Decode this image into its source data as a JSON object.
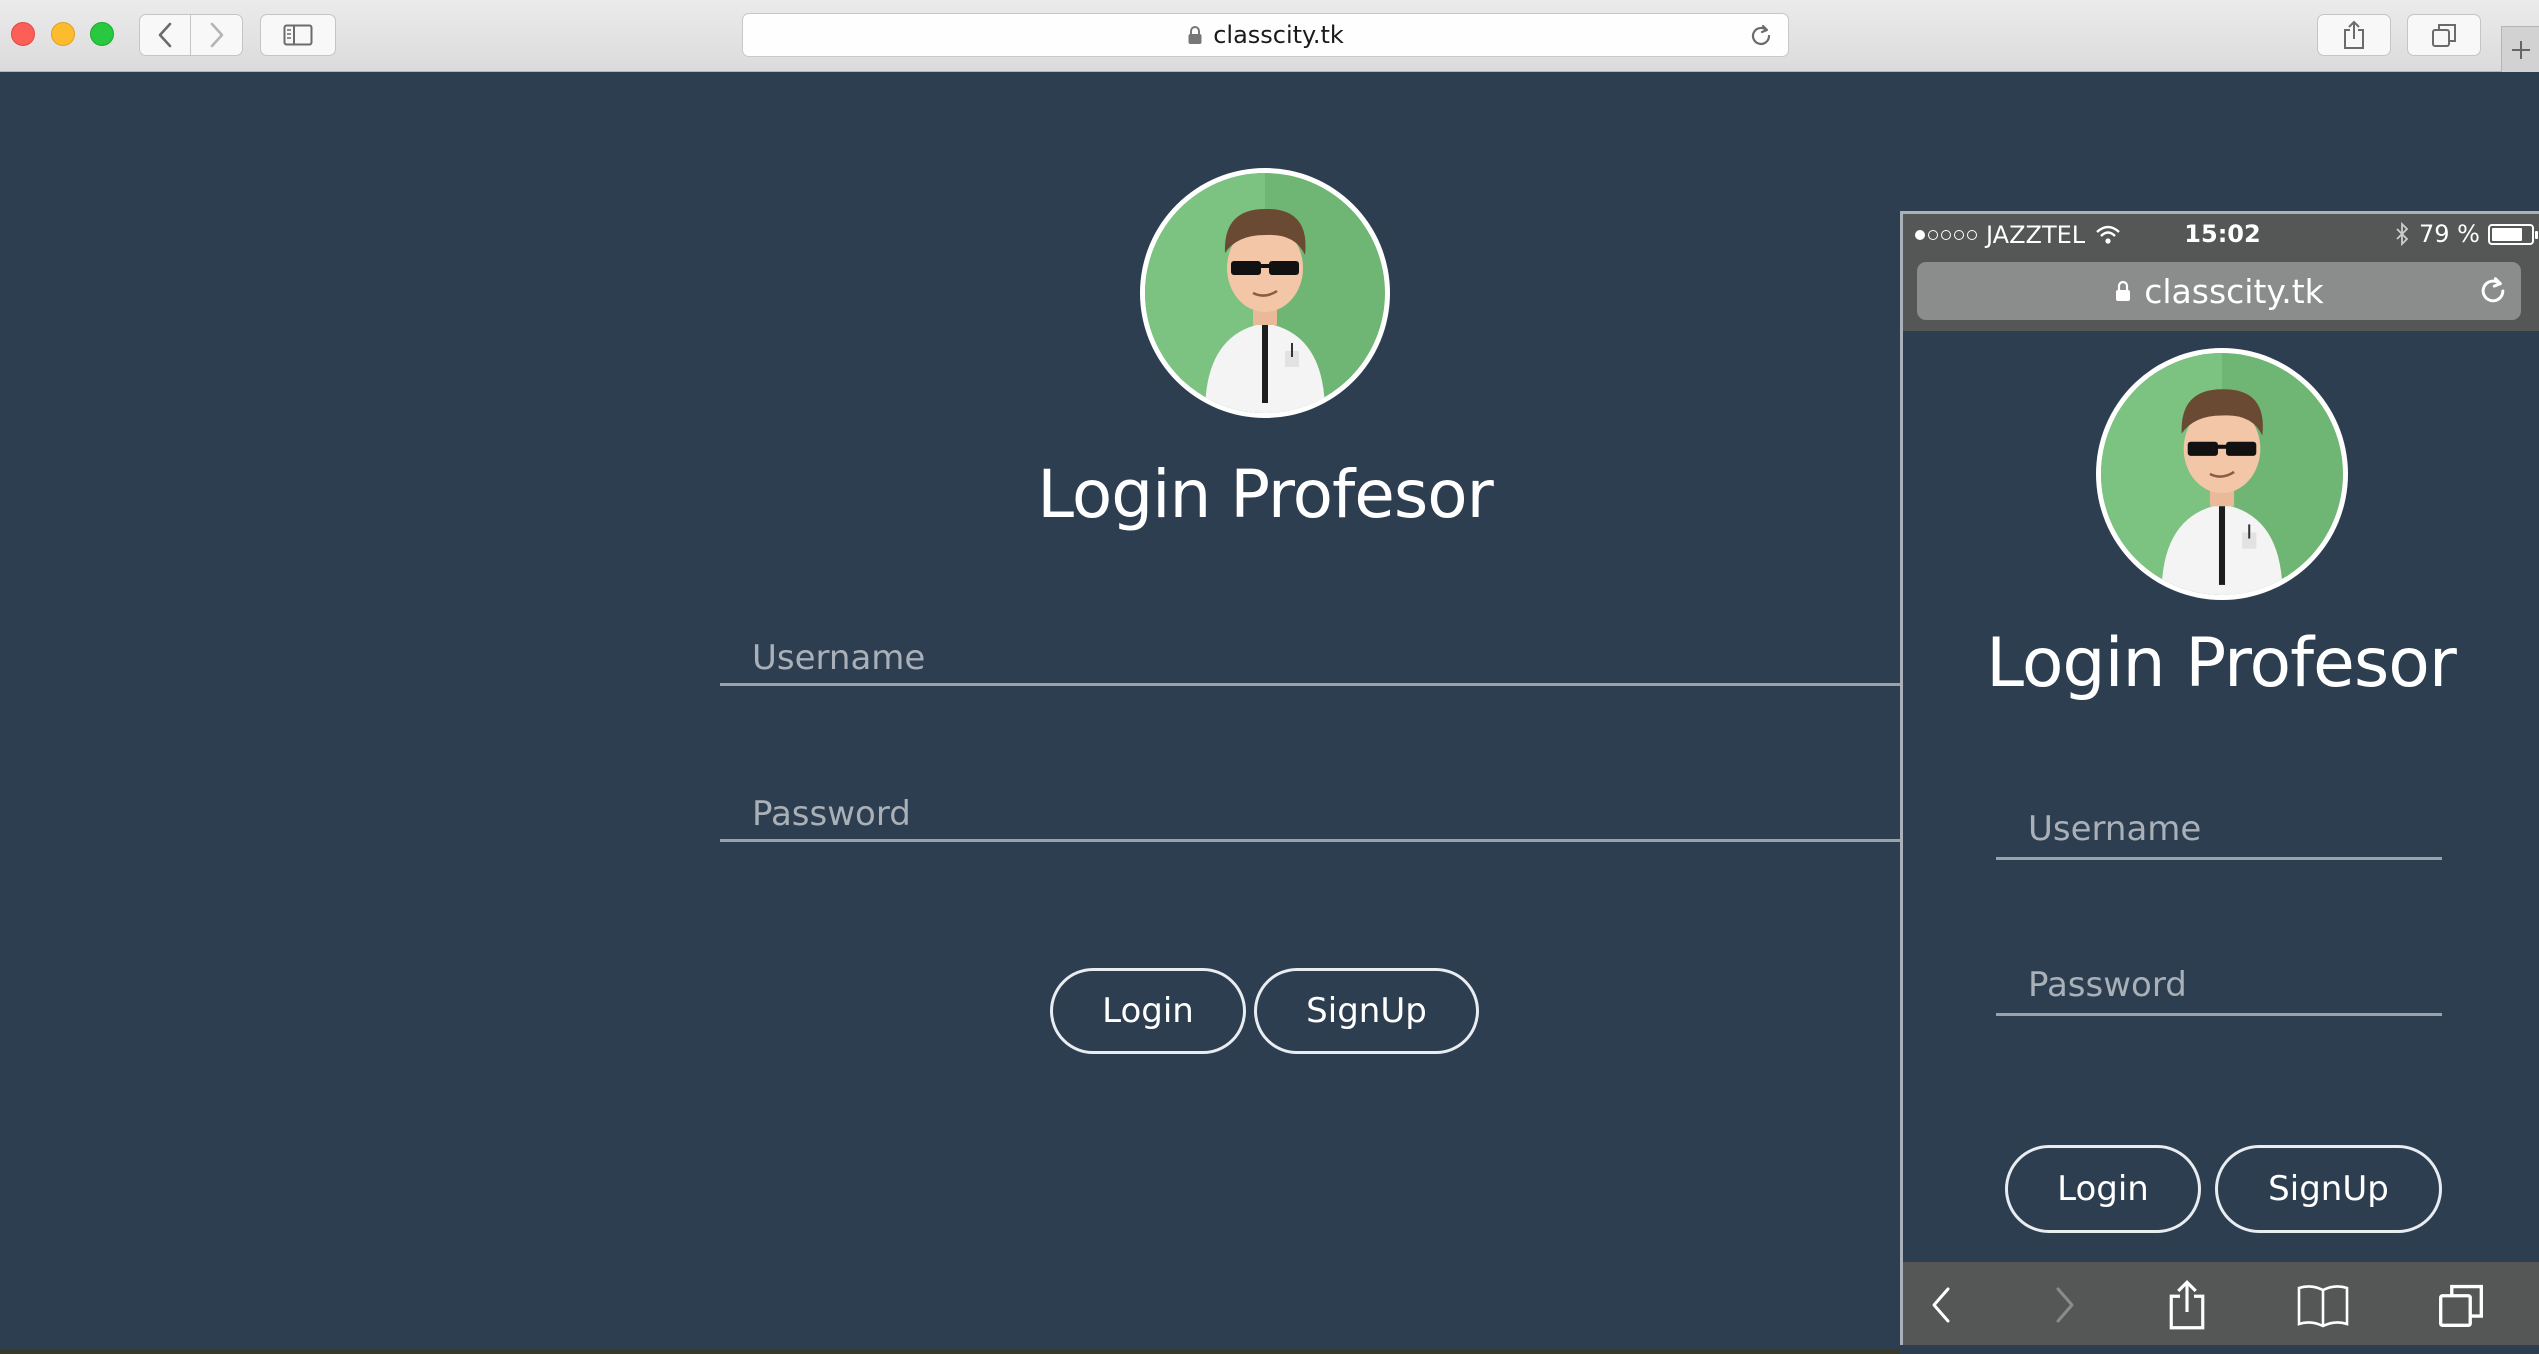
{
  "browser": {
    "url": "classcity.tk"
  },
  "desktop": {
    "title": "Login Profesor",
    "username_placeholder": "Username",
    "password_placeholder": "Password",
    "login_label": "Login",
    "signup_label": "SignUp"
  },
  "phone": {
    "status": {
      "carrier": "JAZZTEL",
      "time": "15:02",
      "battery": "79 %",
      "battery_level": 0.79
    },
    "url": "classcity.tk",
    "title": "Login Profesor",
    "username_placeholder": "Username",
    "password_placeholder": "Password",
    "login_label": "Login",
    "signup_label": "SignUp"
  },
  "colors": {
    "page_background": "#2d3e50",
    "avatar_green": "#6fb674",
    "field_underline": "#9aa2ab"
  },
  "icons": [
    "back-icon",
    "forward-icon",
    "sidebar-icon",
    "lock-icon",
    "reload-icon",
    "share-icon",
    "tabs-icon",
    "new-tab-icon",
    "wifi-icon",
    "bluetooth-icon",
    "battery-icon",
    "bookmarks-icon"
  ]
}
